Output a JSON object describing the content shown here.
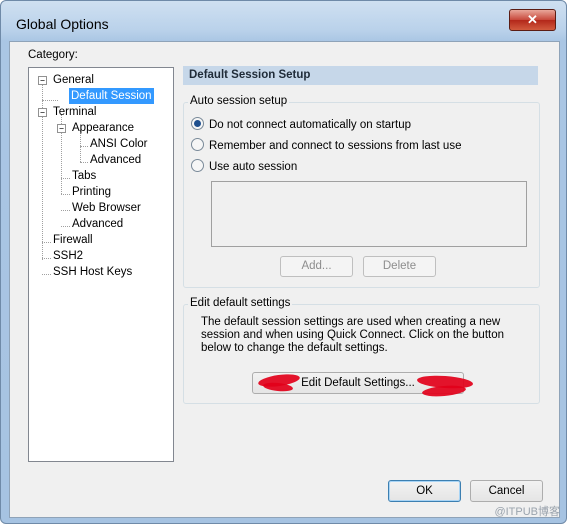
{
  "window": {
    "title": "Global Options",
    "close_label": "✕"
  },
  "category": {
    "label": "Category:",
    "tree": [
      {
        "label": "General",
        "expander": "−"
      },
      {
        "label": "Default Session",
        "selected": true
      },
      {
        "label": "Terminal",
        "expander": "−"
      },
      {
        "label": "Appearance",
        "expander": "−"
      },
      {
        "label": "ANSI Color"
      },
      {
        "label": "Advanced"
      },
      {
        "label": "Tabs"
      },
      {
        "label": "Printing"
      },
      {
        "label": "Web Browser"
      },
      {
        "label": "Advanced"
      },
      {
        "label": "Firewall"
      },
      {
        "label": "SSH2"
      },
      {
        "label": "SSH Host Keys"
      }
    ]
  },
  "panel": {
    "header": "Default Session Setup",
    "auto_session": {
      "title": "Auto session setup",
      "options": [
        {
          "label": "Do not connect automatically on startup",
          "checked": true
        },
        {
          "label": "Remember and connect to sessions from last use",
          "checked": false
        },
        {
          "label": "Use auto session",
          "checked": false
        }
      ],
      "add_label": "Add...",
      "delete_label": "Delete"
    },
    "edit_defaults": {
      "title": "Edit default settings",
      "description": "The default session settings are used when creating a new session and when using Quick Connect.  Click on the button below to change the default settings.",
      "button_label": "Edit Default Settings..."
    }
  },
  "footer": {
    "ok_label": "OK",
    "cancel_label": "Cancel"
  },
  "watermark": "@ITPUB博客"
}
